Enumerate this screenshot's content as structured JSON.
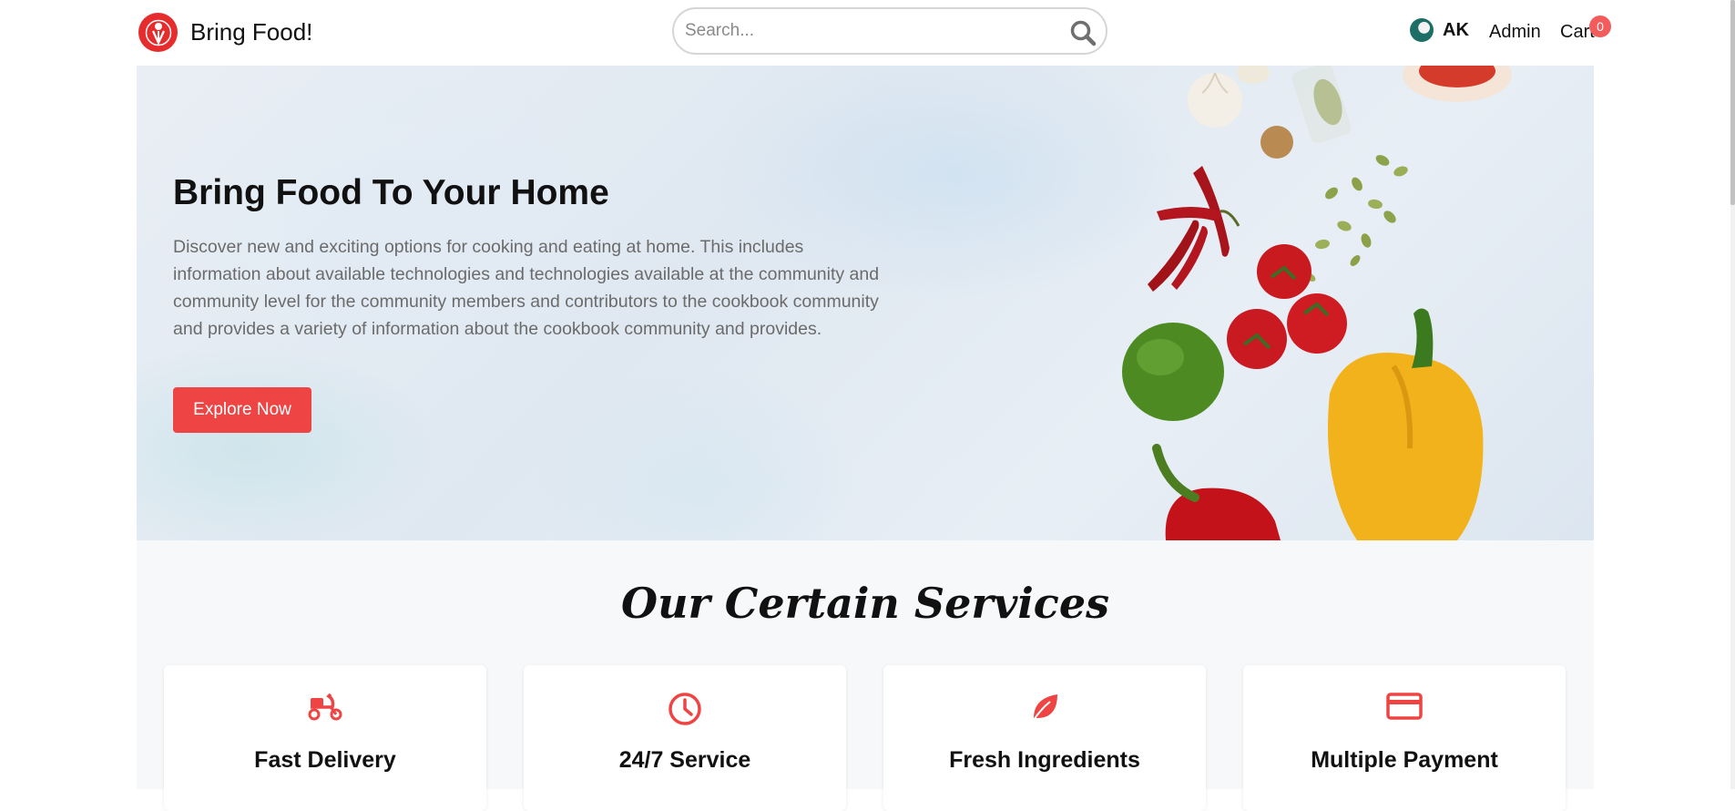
{
  "brand": {
    "name": "Bring Food!",
    "logo_icon": "chef-hat-logo-icon",
    "logo_color": "#e62d2d"
  },
  "search": {
    "placeholder": "Search...",
    "icon": "search-icon"
  },
  "user": {
    "initials": "AK",
    "avatar_icon": "user-avatar"
  },
  "nav": {
    "admin_label": "Admin",
    "cart_label": "Cart",
    "cart_count": "0"
  },
  "hero": {
    "title": "Bring Food To Your Home",
    "description": "Discover new and exciting options for cooking and eating at home. This includes information about available technologies and technologies available at the community and community level for the community members and contributors to the cookbook community and provides a variety of information about the cookbook community and provides.",
    "button_label": "Explore Now"
  },
  "services": {
    "title": "Our Certain Services",
    "items": [
      {
        "title": "Fast Delivery",
        "icon": "scooter-icon"
      },
      {
        "title": "24/7 Service",
        "icon": "clock-icon"
      },
      {
        "title": "Fresh Ingredients",
        "icon": "leaf-icon"
      },
      {
        "title": "Multiple Payment",
        "icon": "credit-card-icon"
      }
    ]
  },
  "colors": {
    "accent": "#ef4444",
    "badge": "#f25c5c"
  }
}
